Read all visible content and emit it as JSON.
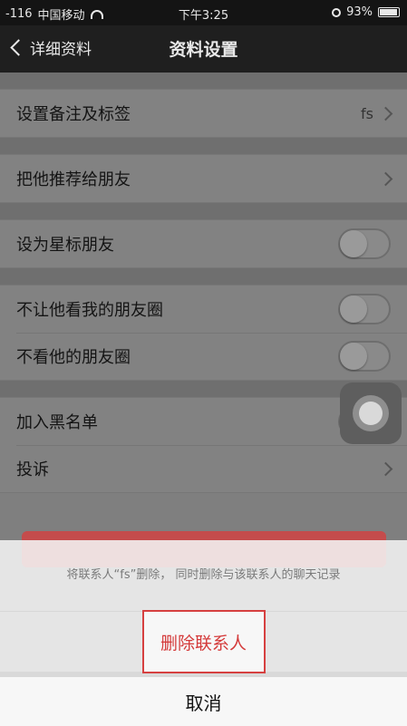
{
  "status_bar": {
    "signal": "-116",
    "carrier": "中国移动",
    "time": "下午3:25",
    "battery": "93%"
  },
  "nav": {
    "back_label": "详细资料",
    "title": "资料设置"
  },
  "settings": {
    "remark": {
      "label": "设置备注及标签",
      "value": "fs"
    },
    "recommend": {
      "label": "把他推荐给朋友"
    },
    "star": {
      "label": "设为星标朋友",
      "on": false
    },
    "hide_moments": {
      "label": "不让他看我的朋友圈",
      "on": false
    },
    "ignore_moments": {
      "label": "不看他的朋友圈",
      "on": false
    },
    "blacklist": {
      "label": "加入黑名单",
      "on": false
    },
    "report": {
      "label": "投诉"
    }
  },
  "action_sheet": {
    "message": "将联系人“fs”删除， 同时删除与该联系人的聊天记录",
    "delete_label": "删除联系人",
    "cancel_label": "取消"
  },
  "colors": {
    "destructive": "#d43a3a",
    "overlay": "#7f7f7f"
  }
}
